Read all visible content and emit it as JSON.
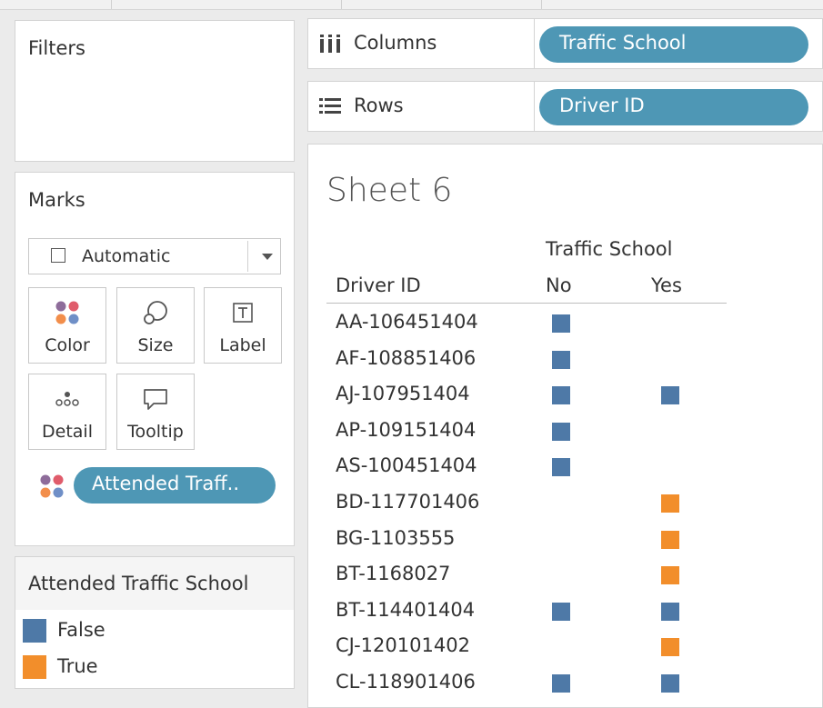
{
  "colors": {
    "false": "#4e79a7",
    "true": "#f28e2b",
    "pill": "#4e97b5"
  },
  "filters": {
    "title": "Filters"
  },
  "marks": {
    "title": "Marks",
    "mark_type": "Automatic",
    "buttons": [
      {
        "label": "Color",
        "icon": "color-dots-icon"
      },
      {
        "label": "Size",
        "icon": "size-icon"
      },
      {
        "label": "Label",
        "icon": "label-icon"
      },
      {
        "label": "Detail",
        "icon": "detail-icon"
      },
      {
        "label": "Tooltip",
        "icon": "tooltip-icon"
      }
    ],
    "color_pill": "Attended Traff.."
  },
  "legend": {
    "title": "Attended Traffic School",
    "items": [
      {
        "label": "False",
        "color": "#4e79a7"
      },
      {
        "label": "True",
        "color": "#f28e2b"
      }
    ]
  },
  "shelves": {
    "columns": {
      "label": "Columns",
      "pill": "Traffic School"
    },
    "rows": {
      "label": "Rows",
      "pill": "Driver ID"
    }
  },
  "sheet": {
    "title": "Sheet 6",
    "column_group_header": "Traffic School",
    "row_header": "Driver ID",
    "column_headers": [
      "No",
      "Yes"
    ],
    "rows": [
      {
        "id": "AA-106451404",
        "no": "False",
        "yes": null
      },
      {
        "id": "AF-108851406",
        "no": "False",
        "yes": null
      },
      {
        "id": "AJ-107951404",
        "no": "False",
        "yes": "False"
      },
      {
        "id": "AP-109151404",
        "no": "False",
        "yes": null
      },
      {
        "id": "AS-100451404",
        "no": "False",
        "yes": null
      },
      {
        "id": "BD-117701406",
        "no": null,
        "yes": "True"
      },
      {
        "id": "BG-1103555",
        "no": null,
        "yes": "True"
      },
      {
        "id": "BT-1168027",
        "no": null,
        "yes": "True"
      },
      {
        "id": "BT-114401404",
        "no": "False",
        "yes": "False"
      },
      {
        "id": "CJ-120101402",
        "no": null,
        "yes": "True"
      },
      {
        "id": "CL-118901406",
        "no": "False",
        "yes": "False"
      }
    ]
  }
}
